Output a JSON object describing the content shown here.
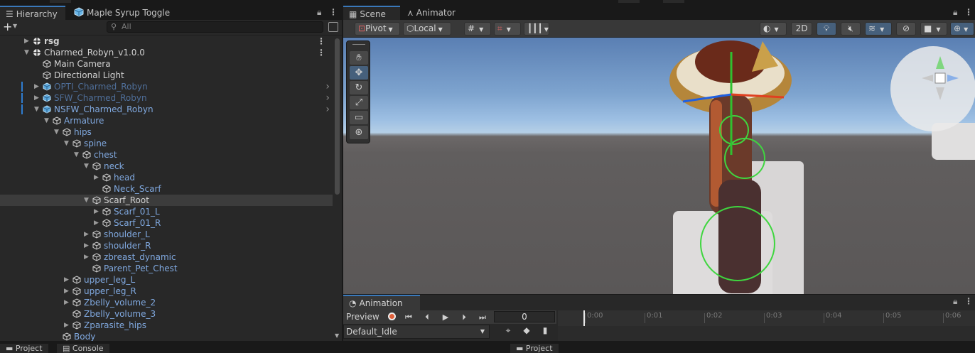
{
  "hierarchy": {
    "tab_label": "Hierarchy",
    "scene_tab_label": "Maple Syrup Toggle",
    "search_placeholder": "All",
    "rows": [
      {
        "label": "rsg",
        "depth": 0,
        "expander": "collapsed",
        "icon": "unity-scene-icon",
        "style": "bold-white",
        "more": true
      },
      {
        "label": "Charmed_Robyn_v1.0.0",
        "depth": 0,
        "expander": "expanded",
        "icon": "unity-scene-icon",
        "style": "white",
        "more": true
      },
      {
        "label": "Main Camera",
        "depth": 1,
        "expander": "none",
        "icon": "gameobject-icon",
        "style": "white"
      },
      {
        "label": "Directional Light",
        "depth": 1,
        "expander": "none",
        "icon": "gameobject-icon",
        "style": "white"
      },
      {
        "label": "OPTI_Charmed_Robyn",
        "depth": 1,
        "expander": "collapsed",
        "icon": "prefab-icon",
        "style": "dim",
        "chevron": true,
        "marker": true
      },
      {
        "label": "SFW_Charmed_Robyn",
        "depth": 1,
        "expander": "collapsed",
        "icon": "prefab-icon",
        "style": "dim",
        "chevron": true,
        "marker": true
      },
      {
        "label": "NSFW_Charmed_Robyn",
        "depth": 1,
        "expander": "expanded",
        "icon": "prefab-icon",
        "style": "blue",
        "chevron": true,
        "marker": true
      },
      {
        "label": "Armature",
        "depth": 2,
        "expander": "expanded",
        "icon": "gameobject-icon",
        "style": "blue"
      },
      {
        "label": "hips",
        "depth": 3,
        "expander": "expanded",
        "icon": "gameobject-icon",
        "style": "blue"
      },
      {
        "label": "spine",
        "depth": 4,
        "expander": "expanded",
        "icon": "gameobject-icon",
        "style": "blue"
      },
      {
        "label": "chest",
        "depth": 5,
        "expander": "expanded",
        "icon": "gameobject-icon",
        "style": "blue"
      },
      {
        "label": "neck",
        "depth": 6,
        "expander": "expanded",
        "icon": "gameobject-icon",
        "style": "blue"
      },
      {
        "label": "head",
        "depth": 7,
        "expander": "collapsed",
        "icon": "gameobject-icon",
        "style": "blue"
      },
      {
        "label": "Neck_Scarf",
        "depth": 7,
        "expander": "none",
        "icon": "gameobject-icon",
        "style": "blue"
      },
      {
        "label": "Scarf_Root",
        "depth": 6,
        "expander": "expanded",
        "icon": "gameobject-icon",
        "style": "white",
        "selected": true
      },
      {
        "label": "Scarf_01_L",
        "depth": 7,
        "expander": "collapsed",
        "icon": "gameobject-icon",
        "style": "blue"
      },
      {
        "label": "Scarf_01_R",
        "depth": 7,
        "expander": "collapsed",
        "icon": "gameobject-icon",
        "style": "blue"
      },
      {
        "label": "shoulder_L",
        "depth": 6,
        "expander": "collapsed",
        "icon": "gameobject-icon",
        "style": "blue"
      },
      {
        "label": "shoulder_R",
        "depth": 6,
        "expander": "collapsed",
        "icon": "gameobject-icon",
        "style": "blue"
      },
      {
        "label": "zbreast_dynamic",
        "depth": 6,
        "expander": "collapsed",
        "icon": "gameobject-icon",
        "style": "blue"
      },
      {
        "label": "Parent_Pet_Chest",
        "depth": 6,
        "expander": "none",
        "icon": "gameobject-icon",
        "style": "blue"
      },
      {
        "label": "upper_leg_L",
        "depth": 4,
        "expander": "collapsed",
        "icon": "gameobject-icon",
        "style": "blue"
      },
      {
        "label": "upper_leg_R",
        "depth": 4,
        "expander": "collapsed",
        "icon": "gameobject-icon",
        "style": "blue"
      },
      {
        "label": "Zbelly_volume_2",
        "depth": 4,
        "expander": "collapsed",
        "icon": "gameobject-icon",
        "style": "blue"
      },
      {
        "label": "Zbelly_volume_3",
        "depth": 4,
        "expander": "none",
        "icon": "gameobject-icon",
        "style": "blue"
      },
      {
        "label": "Zparasite_hips",
        "depth": 4,
        "expander": "collapsed",
        "icon": "gameobject-icon",
        "style": "blue"
      },
      {
        "label": "Body",
        "depth": 3,
        "expander": "none",
        "icon": "gameobject-icon",
        "style": "blue"
      }
    ]
  },
  "scene": {
    "tab_label": "Scene",
    "animator_tab_label": "Animator",
    "pivot_label": "Pivot",
    "local_label": "Local",
    "mode_2d_label": "2D"
  },
  "animation": {
    "tab_label": "Animation",
    "preview_label": "Preview",
    "frame_value": "0",
    "clip_name": "Default_Idle",
    "ticks": [
      "0:00",
      "0:01",
      "0:02",
      "0:03",
      "0:04",
      "0:05",
      "0:06"
    ]
  },
  "bottom_tabs": {
    "project_label": "Project",
    "console_label": "Console",
    "project2_label": "Project"
  },
  "colors": {
    "accent": "#3a79bb",
    "hierarchy_blue": "#80a9e0",
    "panel_bg": "#282828"
  }
}
